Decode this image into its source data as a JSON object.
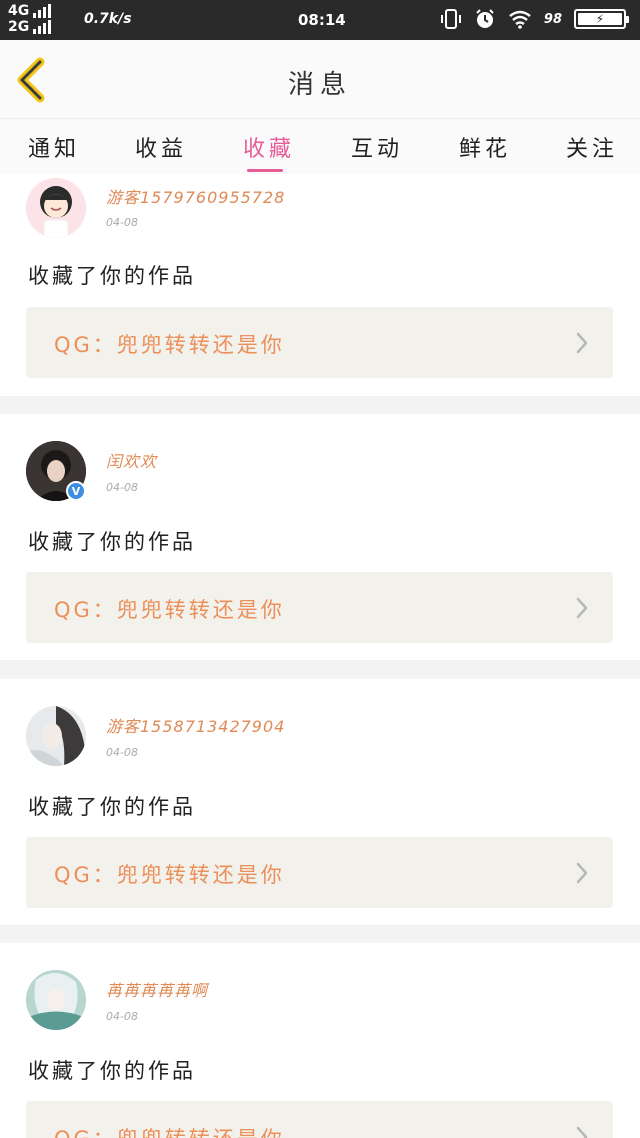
{
  "status_bar": {
    "net_top": "4G",
    "net_bottom": "2G",
    "speed": "0.7k/s",
    "time": "08:14",
    "battery": "98"
  },
  "header": {
    "title": "消息",
    "back_icon": "chevron-left-icon"
  },
  "tabs": [
    {
      "label": "通知"
    },
    {
      "label": "收益"
    },
    {
      "label": "收藏",
      "active": true
    },
    {
      "label": "互动"
    },
    {
      "label": "鲜花"
    },
    {
      "label": "关注"
    }
  ],
  "colors": {
    "accent": "#e85d98",
    "name": "#e08a56",
    "work_text": "#ec8f58",
    "work_bg": "#f2f1ec"
  },
  "feed": [
    {
      "user": "游客1579760955728",
      "date": "04-08",
      "action": "收藏了你的作品",
      "work": "QG：兜兜转转还是你",
      "verified": false
    },
    {
      "user": "闰欢欢",
      "date": "04-08",
      "action": "收藏了你的作品",
      "work": "QG：兜兜转转还是你",
      "verified": true
    },
    {
      "user": "游客1558713427904",
      "date": "04-08",
      "action": "收藏了你的作品",
      "work": "QG：兜兜转转还是你",
      "verified": false
    },
    {
      "user": "苒苒苒苒苒啊",
      "date": "04-08",
      "action": "收藏了你的作品",
      "work": "QG：兜兜转转还是你",
      "verified": false
    }
  ]
}
